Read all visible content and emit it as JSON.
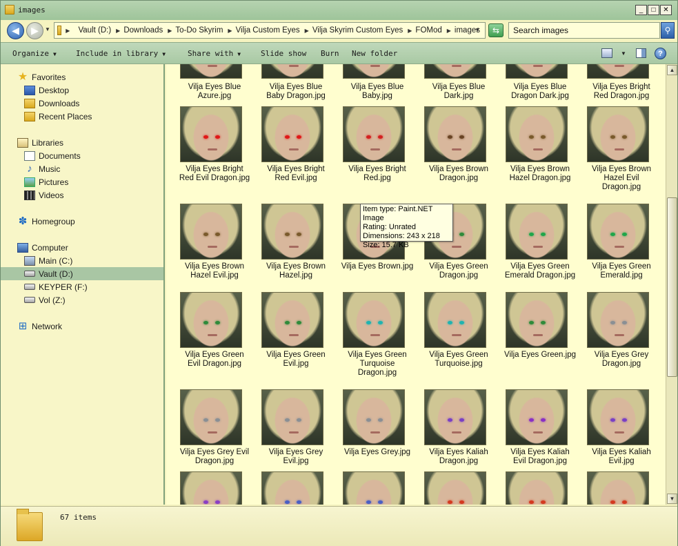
{
  "window": {
    "title": "images"
  },
  "titlebar_buttons": {
    "minimize": "_",
    "maximize": "□",
    "close": "✕"
  },
  "address": {
    "crumbs": [
      "Vault (D:)",
      "Downloads",
      "To-Do Skyrim",
      "Vilja Custom Eyes",
      "Vilja Skyrim Custom Eyes",
      "FOMod",
      "images"
    ],
    "search_placeholder": "Search images"
  },
  "toolbar": {
    "organize": "Organize",
    "include_in_library": "Include in library",
    "share_with": "Share with",
    "slide_show": "Slide show",
    "burn": "Burn",
    "new_folder": "New folder"
  },
  "nav": {
    "favorites": "Favorites",
    "desktop": "Desktop",
    "downloads": "Downloads",
    "recent_places": "Recent Places",
    "libraries": "Libraries",
    "documents": "Documents",
    "music": "Music",
    "pictures": "Pictures",
    "videos": "Videos",
    "homegroup": "Homegroup",
    "computer": "Computer",
    "main_c": "Main (C:)",
    "vault_d": "Vault (D:)",
    "keyper_f": "KEYPER (F:)",
    "vol_z": "Vol (Z:)",
    "network": "Network"
  },
  "files": [
    {
      "label": "Vilja Eyes Blue\nAzure.jpg",
      "eye": "#3f7fc9"
    },
    {
      "label": "Vilja Eyes Blue\nBaby Dragon.jpg",
      "eye": "#6f9fd6"
    },
    {
      "label": "Vilja Eyes Blue\nBaby.jpg",
      "eye": "#7aaae0"
    },
    {
      "label": "Vilja Eyes Blue\nDark.jpg",
      "eye": "#254a8a"
    },
    {
      "label": "Vilja Eyes Blue\nDragon Dark.jpg",
      "eye": "#2d4f8f"
    },
    {
      "label": "Vilja Eyes Bright\nRed Dragon.jpg",
      "eye": "#d42020"
    },
    {
      "label": "Vilja Eyes Bright\nRed Evil Dragon.jpg",
      "eye": "#e01818"
    },
    {
      "label": "Vilja Eyes Bright\nRed Evil.jpg",
      "eye": "#e01818"
    },
    {
      "label": "Vilja Eyes Bright\nRed.jpg",
      "eye": "#d42020"
    },
    {
      "label": "Vilja Eyes Brown\nDragon.jpg",
      "eye": "#6a4424"
    },
    {
      "label": "Vilja Eyes Brown\nHazel Dragon.jpg",
      "eye": "#7a5a2c"
    },
    {
      "label": "Vilja Eyes Brown\nHazel Evil\nDragon.jpg",
      "eye": "#7a5a2c"
    },
    {
      "label": "Vilja Eyes Brown\nHazel Evil.jpg",
      "eye": "#7a5a2c"
    },
    {
      "label": "Vilja Eyes Brown\nHazel.jpg",
      "eye": "#7a5a2c"
    },
    {
      "label": "Vilja Eyes Brown.jpg",
      "eye": "#5a3a20"
    },
    {
      "label": "Vilja Eyes Green\nDragon.jpg",
      "eye": "#2f8a3a"
    },
    {
      "label": "Vilja Eyes Green\nEmerald Dragon.jpg",
      "eye": "#1fa64a"
    },
    {
      "label": "Vilja Eyes Green\nEmerald.jpg",
      "eye": "#1fa64a"
    },
    {
      "label": "Vilja Eyes Green\nEvil Dragon.jpg",
      "eye": "#2f8a3a"
    },
    {
      "label": "Vilja Eyes Green\nEvil.jpg",
      "eye": "#2f8a3a"
    },
    {
      "label": "Vilja Eyes Green\nTurquoise\nDragon.jpg",
      "eye": "#1fb3b0"
    },
    {
      "label": "Vilja Eyes Green\nTurquoise.jpg",
      "eye": "#1fb3b0"
    },
    {
      "label": "Vilja Eyes Green.jpg",
      "eye": "#2f8a3a"
    },
    {
      "label": "Vilja Eyes Grey\nDragon.jpg",
      "eye": "#8a8f94"
    },
    {
      "label": "Vilja Eyes Grey Evil\nDragon.jpg",
      "eye": "#8a8f94"
    },
    {
      "label": "Vilja Eyes Grey\nEvil.jpg",
      "eye": "#8a8f94"
    },
    {
      "label": "Vilja Eyes Grey.jpg",
      "eye": "#8a8f94"
    },
    {
      "label": "Vilja Eyes Kaliah\nDragon.jpg",
      "eye": "#7a3fc4"
    },
    {
      "label": "Vilja Eyes Kaliah\nEvil Dragon.jpg",
      "eye": "#8a2fc4"
    },
    {
      "label": "Vilja Eyes Kaliah\nEvil.jpg",
      "eye": "#7a3fc4"
    },
    {
      "label": "",
      "eye": "#8a3fc4"
    },
    {
      "label": "",
      "eye": "#4a5fc4"
    },
    {
      "label": "",
      "eye": "#4a5fc4"
    },
    {
      "label": "",
      "eye": "#d43a20"
    },
    {
      "label": "",
      "eye": "#d43a20"
    },
    {
      "label": "",
      "eye": "#d43a20"
    }
  ],
  "tooltip": {
    "line1": "Item type: Paint.NET Image",
    "line2": "Rating: Unrated",
    "line3": "Dimensions: 243 x 218",
    "line4": "Size: 15.7 KB"
  },
  "details": {
    "item_count": "67 items"
  }
}
